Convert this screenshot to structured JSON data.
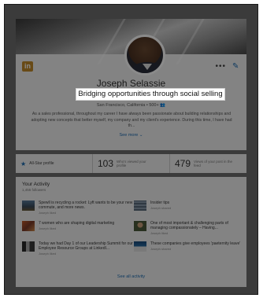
{
  "profile": {
    "name": "Joseph Selassie",
    "headline": "Bridging opportunities through social selling",
    "location": "San Francisco, California • 500+ 👥",
    "summary": "As a sales professional, throughout my career I have always been passionate about building relationships and adopting new concepts that better myself, my company and my client's experience. During this time, I have had th...",
    "see_more": "See more",
    "brand_badge": "in"
  },
  "stats": {
    "all_star_label": "All-Star profile",
    "viewed_count": "103",
    "viewed_label": "Who's viewed your profile",
    "views_count": "479",
    "views_label": "Views of your post in the feed"
  },
  "activity": {
    "title": "Your Activity",
    "followers": "1,455 followers",
    "items": [
      {
        "text": "Spewll is recycling a rocket: Lyft wants to be your new commute, and more news.",
        "meta": "Joseph liked"
      },
      {
        "text": "Insider tips",
        "meta": "Joseph shared"
      },
      {
        "text": "7 women who are shaping digital marketing",
        "meta": "Joseph liked"
      },
      {
        "text": "One of most important & challenging parts of managing compassionately – Having...",
        "meta": "Joseph liked"
      },
      {
        "text": "Today we had Day 1 of our Leadership Summit for our Employee Resource Groups at LinkedI...",
        "meta": "Joseph liked"
      },
      {
        "text": "These companies give employees 'paeternity leave'",
        "meta": "Joseph shared"
      }
    ],
    "see_all": "See all activity"
  },
  "colors": {
    "accent": "#1a6ab0",
    "overlay": "rgba(0,0,0,0.46)"
  }
}
